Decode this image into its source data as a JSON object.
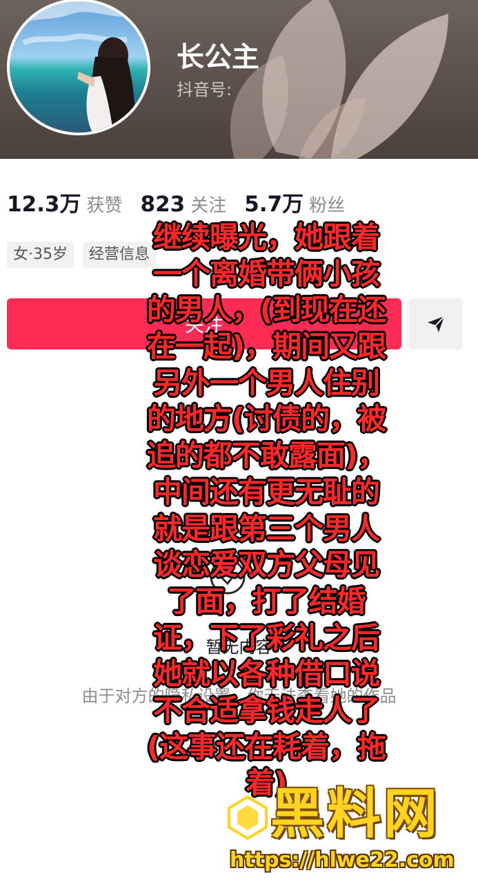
{
  "profile": {
    "name": "长公主",
    "douyin_id_label": "抖音号:",
    "avatar_icon": "avatar-photo-icon"
  },
  "stats": [
    {
      "value": "12.3万",
      "label": "获赞"
    },
    {
      "value": "823",
      "label": "关注"
    },
    {
      "value": "5.7万",
      "label": "粉丝"
    }
  ],
  "tags": [
    "女·35岁",
    "经营信息"
  ],
  "actions": {
    "follow_label": "关注",
    "share_icon": "send-icon"
  },
  "empty_state": {
    "title": "暂无内容",
    "subtitle": "由于对方的隐私设置，你无法查看她的作品"
  },
  "overlay_text": [
    "继续曝光，她跟着",
    "一个离婚带俩小孩",
    "的男人，(到现在还",
    "在一起)，期间又跟",
    "另外一个男人住别",
    "的地方(讨债的，被",
    "追的都不敢露面)，",
    "中间还有更无耻的",
    "就是跟第三个男人",
    "谈恋爱双方父母见",
    "了面，打了结婚",
    "证，下了彩礼之后",
    "她就以各种借口说",
    "不合适拿钱走人了",
    "(这事还在耗着，拖",
    "着)"
  ],
  "watermark": {
    "brand": "黑料网",
    "url": "https://hlwe22.com"
  },
  "colors": {
    "accent": "#fe2c55",
    "overlay_text": "#ff2828",
    "watermark": "#ffd41f"
  }
}
